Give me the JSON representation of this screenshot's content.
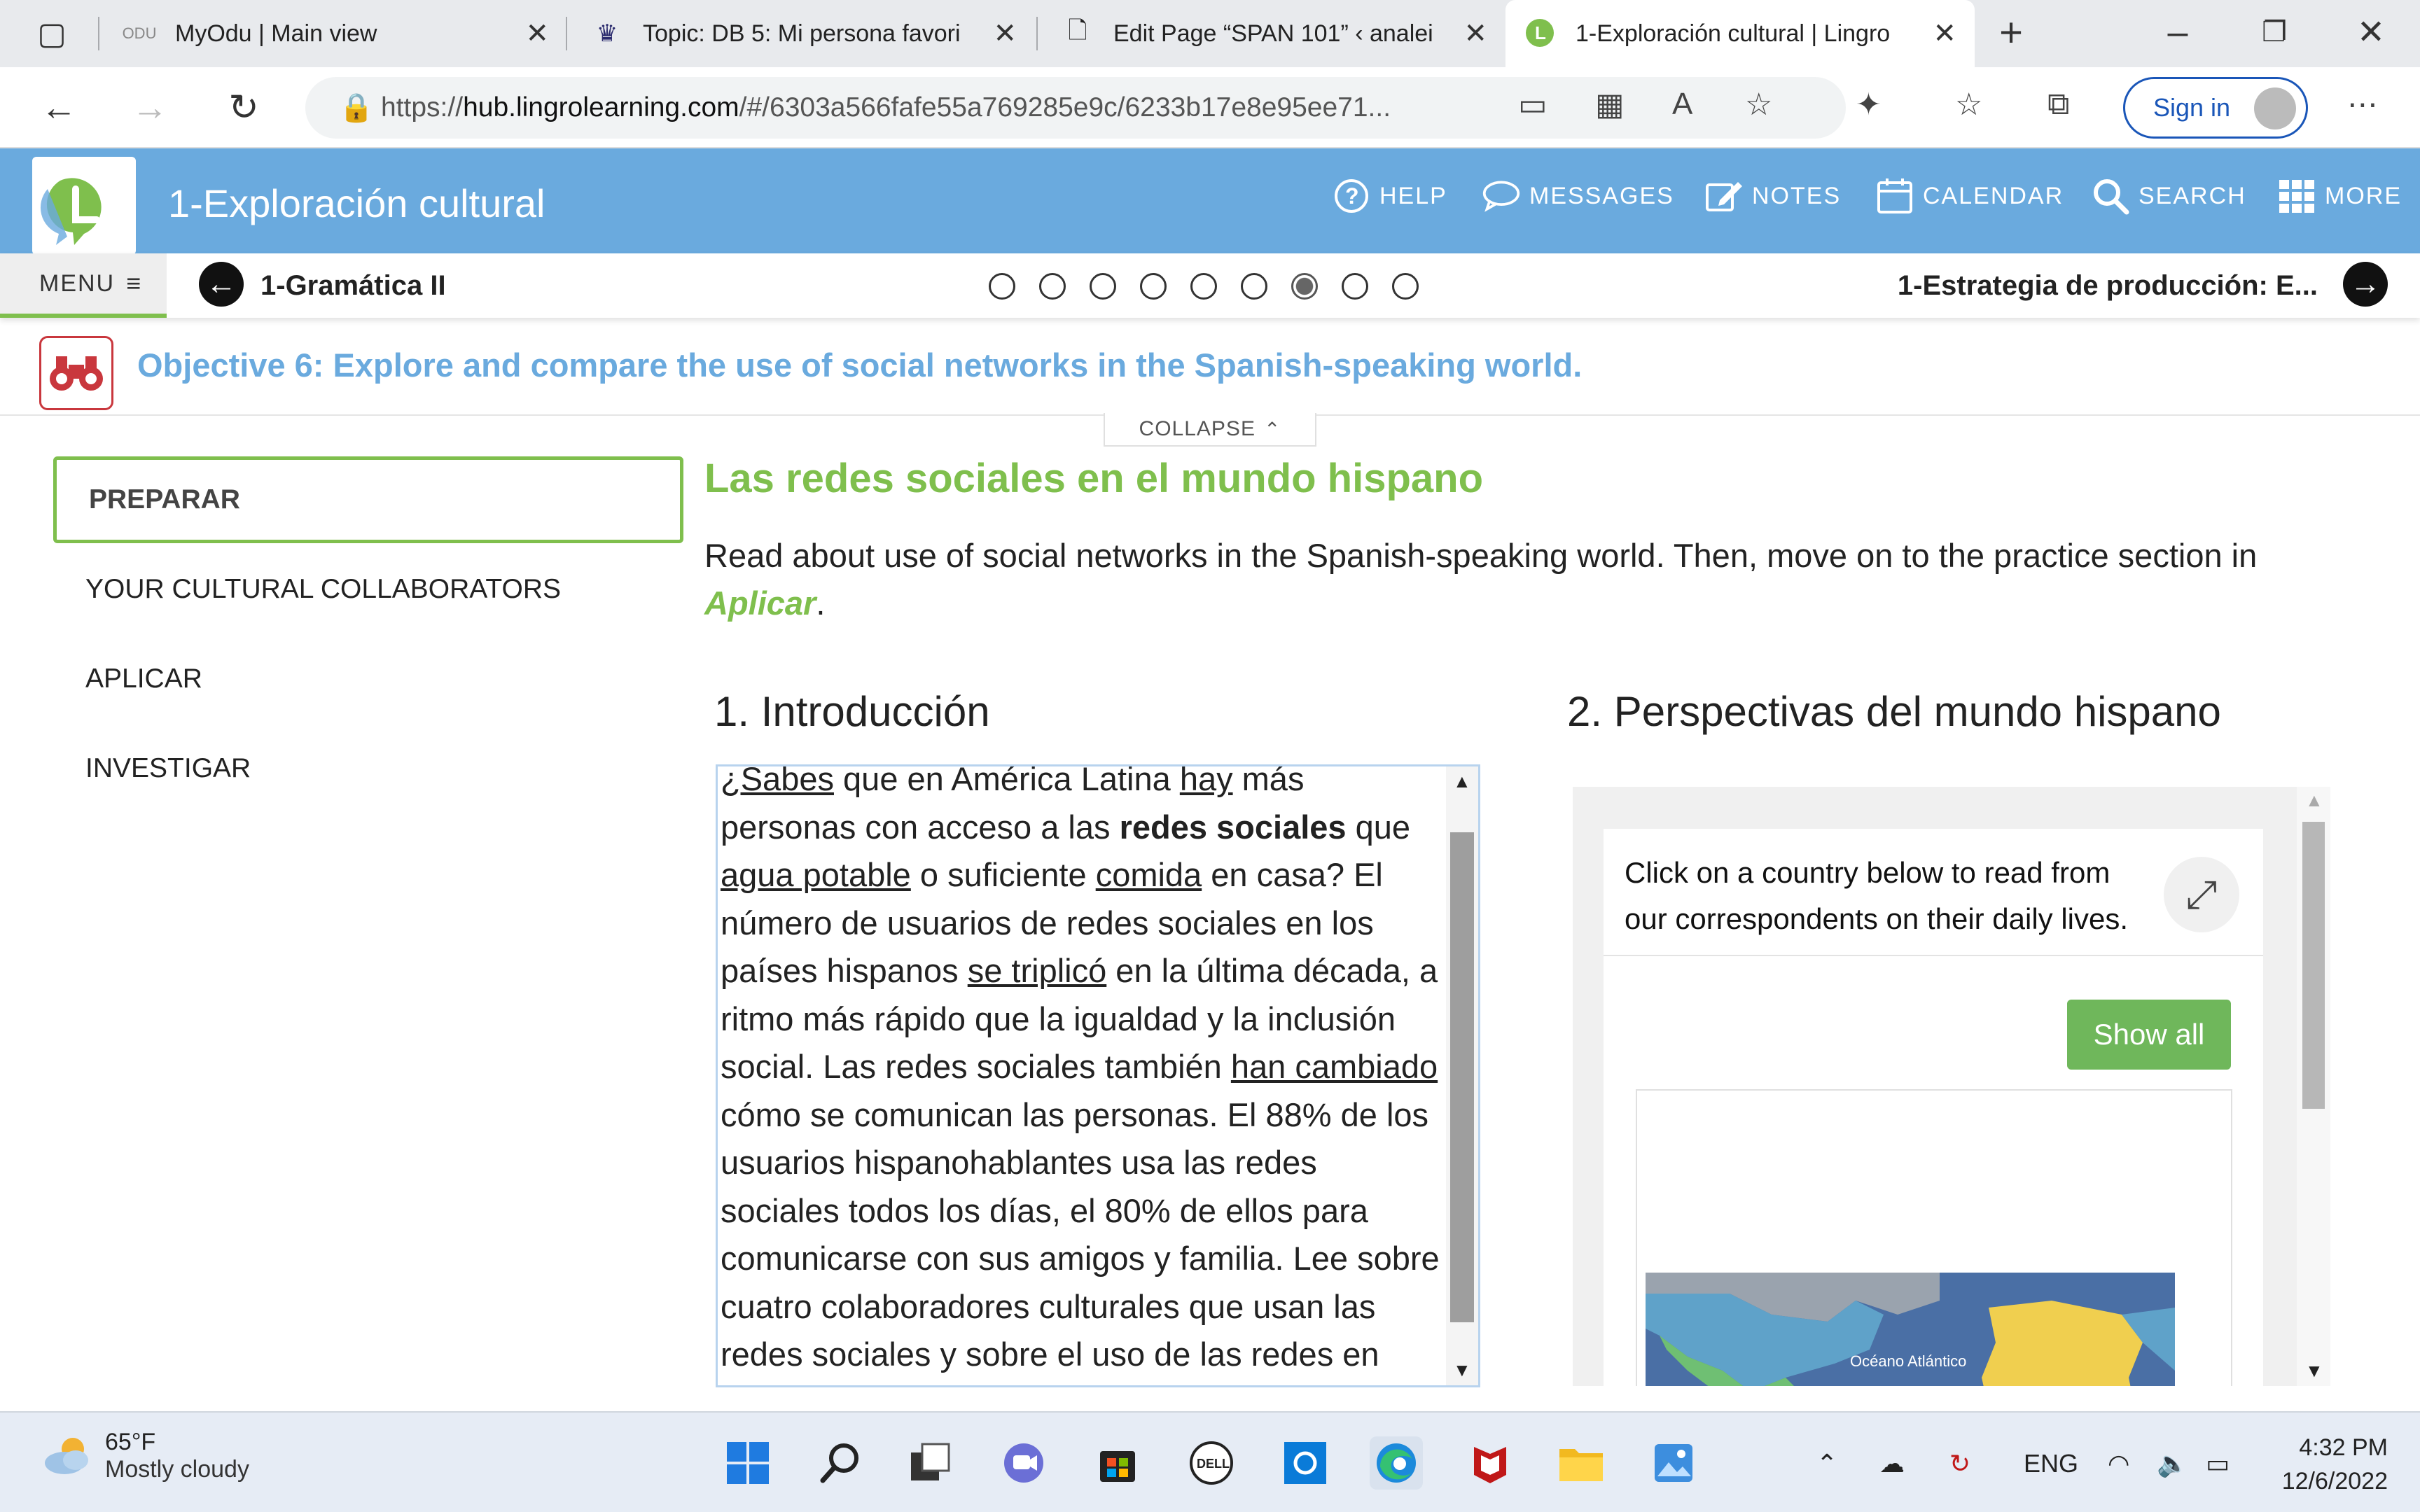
{
  "browser": {
    "tabs": [
      {
        "title": "MyOdu | Main view",
        "icon": "odu-icon"
      },
      {
        "title": "Topic: DB 5: Mi persona favori",
        "icon": "crown-icon"
      },
      {
        "title": "Edit Page “SPAN 101” ‹ analei",
        "icon": "page-icon"
      },
      {
        "title": "1-Exploración cultural | Lingro",
        "icon": "lingro-icon",
        "active": true
      }
    ],
    "url_prefix": "https://",
    "url_domain": "hub.lingrolearning.com",
    "url_path": "/#/6303a566fafe55a769285e9c/6233b17e8e95ee71...",
    "sign_in": "Sign in"
  },
  "app": {
    "title": "1-Exploración cultural",
    "nav": {
      "help": "HELP",
      "messages": "MESSAGES",
      "notes": "NOTES",
      "calendar": "CALENDAR",
      "search": "SEARCH",
      "more": "MORE"
    }
  },
  "subnav": {
    "menu": "MENU",
    "prev": "1-Gramática II",
    "next": "1-Estrategia de producción: E...",
    "dot_count": 9,
    "current_dot": 7
  },
  "objective": {
    "text": "Objective 6: Explore and compare the use of social networks in the Spanish-speaking world.",
    "collapse": "COLLAPSE"
  },
  "sidebar": {
    "items": [
      {
        "label": "PREPARAR",
        "active": true
      },
      {
        "label": "YOUR CULTURAL COLLABORATORS"
      },
      {
        "label": "APLICAR"
      },
      {
        "label": "INVESTIGAR"
      }
    ]
  },
  "main": {
    "title": "Las redes sociales en el mundo hispano",
    "desc_before": "Read about use of social networks in the Spanish-speaking world. Then, move on to the practice section in ",
    "desc_link": "Aplicar",
    "desc_after": ".",
    "section1_title": "1. Introducción",
    "section2_title": "2. Perspectivas del mundo hispano",
    "intro_parts": [
      {
        "t": "¿Sabes",
        "u": true
      },
      {
        "t": " que en América Latina "
      },
      {
        "t": "hay",
        "u": true
      },
      {
        "t": " más personas con acceso a las "
      },
      {
        "t": "redes sociales",
        "b": true
      },
      {
        "t": " que "
      },
      {
        "t": "agua potable",
        "u": true
      },
      {
        "t": " o suficiente "
      },
      {
        "t": "comida",
        "u": true
      },
      {
        "t": " en casa? El número de usuarios de redes sociales en los países hispanos "
      },
      {
        "t": "se triplicó",
        "u": true
      },
      {
        "t": " en la última década, a ritmo más rápido que la igualdad y la inclusión social. Las redes sociales también "
      },
      {
        "t": "han cambiado",
        "u": true
      },
      {
        "t": " cómo se comunican las personas. El 88% de los usuarios hispanohablantes usa las redes sociales todos los días, el 80% de ellos para comunicarse con sus amigos y familia. Lee sobre cuatro colaboradores culturales que usan las redes sociales y sobre el uso de las redes en"
      }
    ],
    "perspectives": {
      "instruction": "Click on a country below to read from our correspondents on their daily lives.",
      "show_all": "Show all",
      "map_label": "Océano Atlántico"
    }
  },
  "taskbar": {
    "weather_temp": "65°F",
    "weather_desc": "Mostly cloudy",
    "lang": "ENG",
    "time": "4:32 PM",
    "date": "12/6/2022"
  }
}
